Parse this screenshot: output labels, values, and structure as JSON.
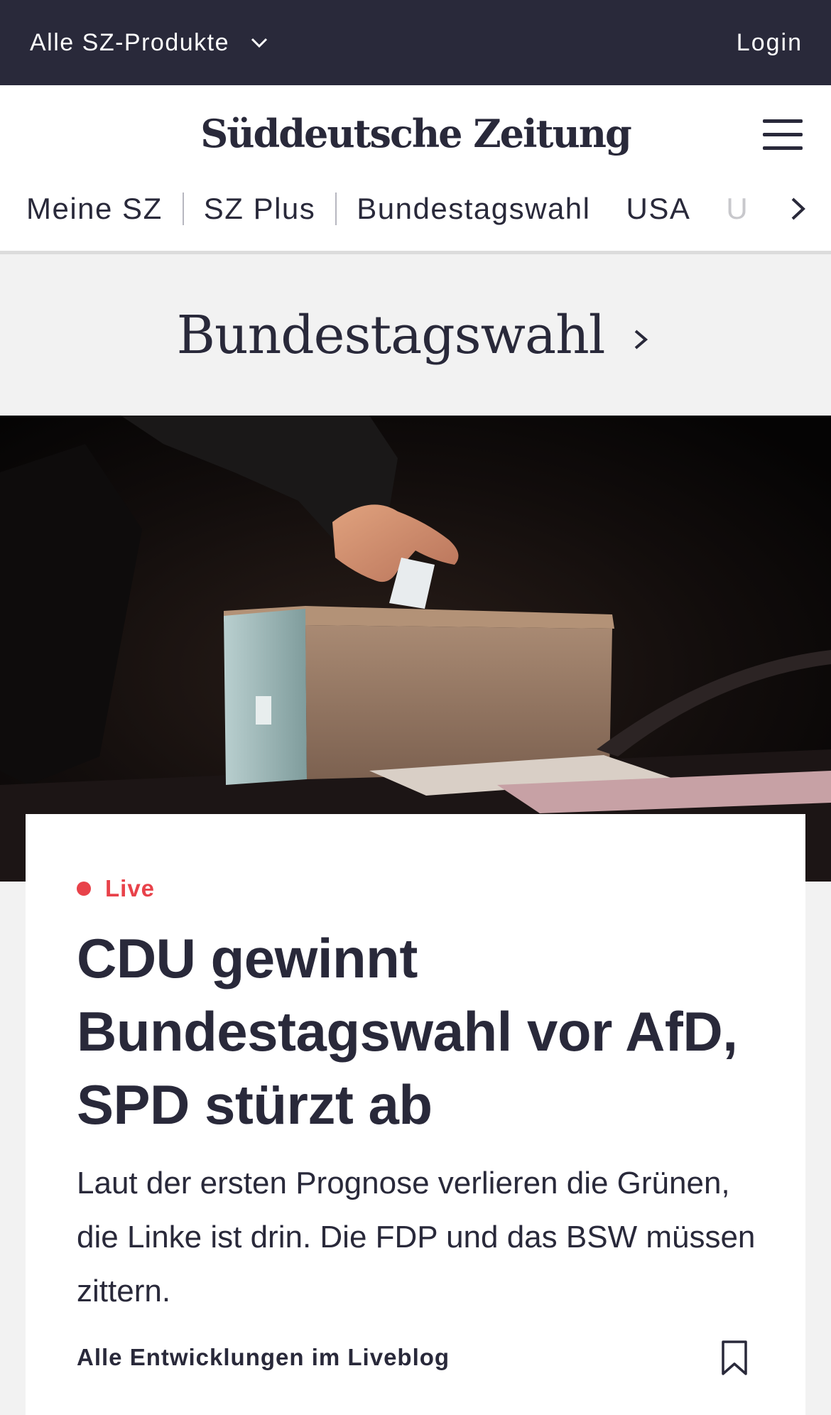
{
  "topbar": {
    "products_label": "Alle SZ-Produkte",
    "login_label": "Login",
    "background": "#29293a"
  },
  "header": {
    "logo_text": "Süddeutsche Zeitung",
    "menu_icon": "hamburger-menu-icon"
  },
  "nav": {
    "items": [
      "Meine SZ",
      "SZ Plus",
      "Bundestagswahl",
      "USA",
      "U"
    ],
    "scroll_icon": "chevron-right-icon"
  },
  "section": {
    "title": "Bundestagswahl",
    "icon": "chevron-right-icon"
  },
  "hero": {
    "icon": "ballot-box-photo"
  },
  "article": {
    "live_label": "Live",
    "headline": "CDU gewinnt Bundestagswahl vor AfD, SPD stürzt ab",
    "teaser": "Laut der ersten Prognose verlieren die Grünen, die Linke ist drin. Die FDP und das BSW müssen zittern.",
    "more_link": "Alle Entwicklungen im Liveblog",
    "bookmark_icon": "bookmark-icon",
    "live_color": "#e8424a"
  }
}
